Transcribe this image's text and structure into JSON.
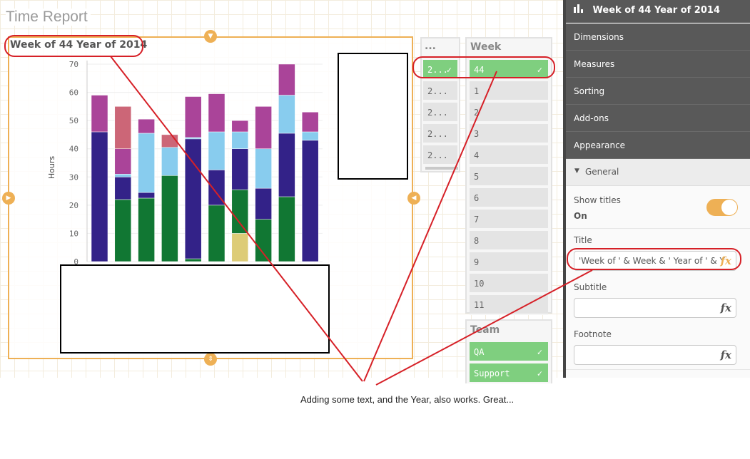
{
  "app": {
    "title": "Time Report"
  },
  "chart": {
    "title": "Week of 44 Year of 2014"
  },
  "chart_data": {
    "type": "bar",
    "stacked": true,
    "title": "Week of 44 Year of 2014",
    "xlabel": "",
    "ylabel": "Hours",
    "ylim": [
      0,
      70
    ],
    "yticks": [
      0,
      10,
      20,
      30,
      40,
      50,
      60,
      70
    ],
    "categories": [
      "",
      "",
      "",
      "",
      "",
      "",
      "",
      "",
      "",
      ""
    ],
    "stacks": [
      [
        {
          "v": 46,
          "c": "#332288"
        },
        {
          "v": 13,
          "c": "#aa4499"
        }
      ],
      [
        {
          "v": 22,
          "c": "#117733"
        },
        {
          "v": 8,
          "c": "#332288"
        },
        {
          "v": 1,
          "c": "#88ccee"
        },
        {
          "v": 9,
          "c": "#aa4499"
        },
        {
          "v": 15,
          "c": "#cc6677"
        }
      ],
      [
        {
          "v": 22.5,
          "c": "#117733"
        },
        {
          "v": 2,
          "c": "#332288"
        },
        {
          "v": 21,
          "c": "#88ccee"
        },
        {
          "v": 5,
          "c": "#aa4499"
        }
      ],
      [
        {
          "v": 30.5,
          "c": "#117733"
        },
        {
          "v": 10,
          "c": "#88ccee"
        },
        {
          "v": 4.5,
          "c": "#cc6677"
        }
      ],
      [
        {
          "v": 1,
          "c": "#117733"
        },
        {
          "v": 42.5,
          "c": "#332288"
        },
        {
          "v": 0.5,
          "c": "#88ccee"
        },
        {
          "v": 14.5,
          "c": "#aa4499"
        }
      ],
      [
        {
          "v": 20,
          "c": "#117733"
        },
        {
          "v": 12.5,
          "c": "#332288"
        },
        {
          "v": 13.5,
          "c": "#88ccee"
        },
        {
          "v": 13.5,
          "c": "#aa4499"
        }
      ],
      [
        {
          "v": 10,
          "c": "#ddcc77"
        },
        {
          "v": 15.5,
          "c": "#117733"
        },
        {
          "v": 14.5,
          "c": "#332288"
        },
        {
          "v": 6,
          "c": "#88ccee"
        },
        {
          "v": 4,
          "c": "#aa4499"
        }
      ],
      [
        {
          "v": 15,
          "c": "#117733"
        },
        {
          "v": 11,
          "c": "#332288"
        },
        {
          "v": 14,
          "c": "#88ccee"
        },
        {
          "v": 15,
          "c": "#aa4499"
        }
      ],
      [
        {
          "v": 23,
          "c": "#117733"
        },
        {
          "v": 22.5,
          "c": "#332288"
        },
        {
          "v": 13.5,
          "c": "#88ccee"
        },
        {
          "v": 11,
          "c": "#aa4499"
        }
      ],
      [
        {
          "v": 43,
          "c": "#332288"
        },
        {
          "v": 3,
          "c": "#88ccee"
        },
        {
          "v": 7,
          "c": "#aa4499"
        }
      ]
    ]
  },
  "filters": {
    "year": {
      "header": "...",
      "items": [
        {
          "label": "2...",
          "selected": true
        },
        {
          "label": "2...",
          "selected": false
        },
        {
          "label": "2...",
          "selected": false
        },
        {
          "label": "2...",
          "selected": false
        },
        {
          "label": "2...",
          "selected": false
        }
      ]
    },
    "week": {
      "header": "Week",
      "items": [
        {
          "label": "44",
          "selected": true
        },
        {
          "label": "1",
          "selected": false
        },
        {
          "label": "2",
          "selected": false
        },
        {
          "label": "3",
          "selected": false
        },
        {
          "label": "4",
          "selected": false
        },
        {
          "label": "5",
          "selected": false
        },
        {
          "label": "6",
          "selected": false
        },
        {
          "label": "7",
          "selected": false
        },
        {
          "label": "8",
          "selected": false
        },
        {
          "label": "9",
          "selected": false
        },
        {
          "label": "10",
          "selected": false
        },
        {
          "label": "11",
          "selected": false
        }
      ]
    },
    "team": {
      "header": "Team",
      "items": [
        {
          "label": "QA",
          "selected": true
        },
        {
          "label": "Support",
          "selected": true
        }
      ]
    }
  },
  "panel": {
    "title": "Week of 44 Year of 2014",
    "sections": [
      "Dimensions",
      "Measures",
      "Sorting",
      "Add-ons",
      "Appearance"
    ],
    "general_label": "General",
    "show_titles_label": "Show titles",
    "show_titles_value": "On",
    "title_label": "Title",
    "title_value": "'Week of ' & Week & ' Year of ' & Y",
    "subtitle_label": "Subtitle",
    "subtitle_value": "",
    "footnote_label": "Footnote",
    "footnote_value": "",
    "fx": "fx"
  },
  "annotation": {
    "caption": "Adding some text, and the Year, also works. Great..."
  },
  "colors": {
    "accent": "#eeb055",
    "selected": "#7fcf7f",
    "annotation": "#d62027",
    "panel_header": "#595959"
  }
}
